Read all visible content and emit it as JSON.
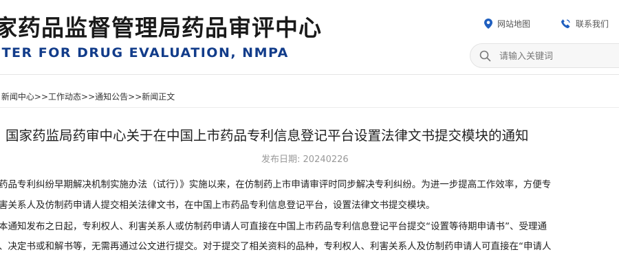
{
  "header": {
    "title_cn": "家药品监督管理局药品审评中心",
    "title_en": "ITER FOR DRUG EVALUATION, NMPA",
    "site_map_label": "网站地图",
    "contact_label": "联系我们",
    "search_placeholder": "请输入关键词"
  },
  "breadcrumb": {
    "items": [
      ":",
      "新闻中心",
      ">>工作动态",
      ">>通知公告",
      ">>新闻正文"
    ]
  },
  "article": {
    "title": "国家药监局药审中心关于在中国上市药品专利信息登记平台设置法律文书提交模块的通知",
    "date_label": "发布日期:",
    "date_value": "20240226",
    "paragraphs": [
      "药品专利纠纷早期解决机制实施办法（试行）》实施以来，在仿制药上市申请审评时同步解决专利纠纷。为进一步提高工作效率，方便专",
      "害关系人及仿制药申请人提交相关法律文书，在中国上市药品专利信息登记平台，设置法律文书提交模块。",
      "本通知发布之日起，专利权人、利害关系人或仿制药申请人可直接在中国上市药品专利信息登记平台提交“设置等待期申请书”、受理通",
      "、决定书或和解书等，无需再通过公文进行提交。对于提交了相关资料的品种，专利权人、利害关系人及仿制药申请人可直接在“申请人"
    ]
  },
  "colors": {
    "title_en": "#123c8a",
    "icon_blue": "#1f5fbf"
  }
}
